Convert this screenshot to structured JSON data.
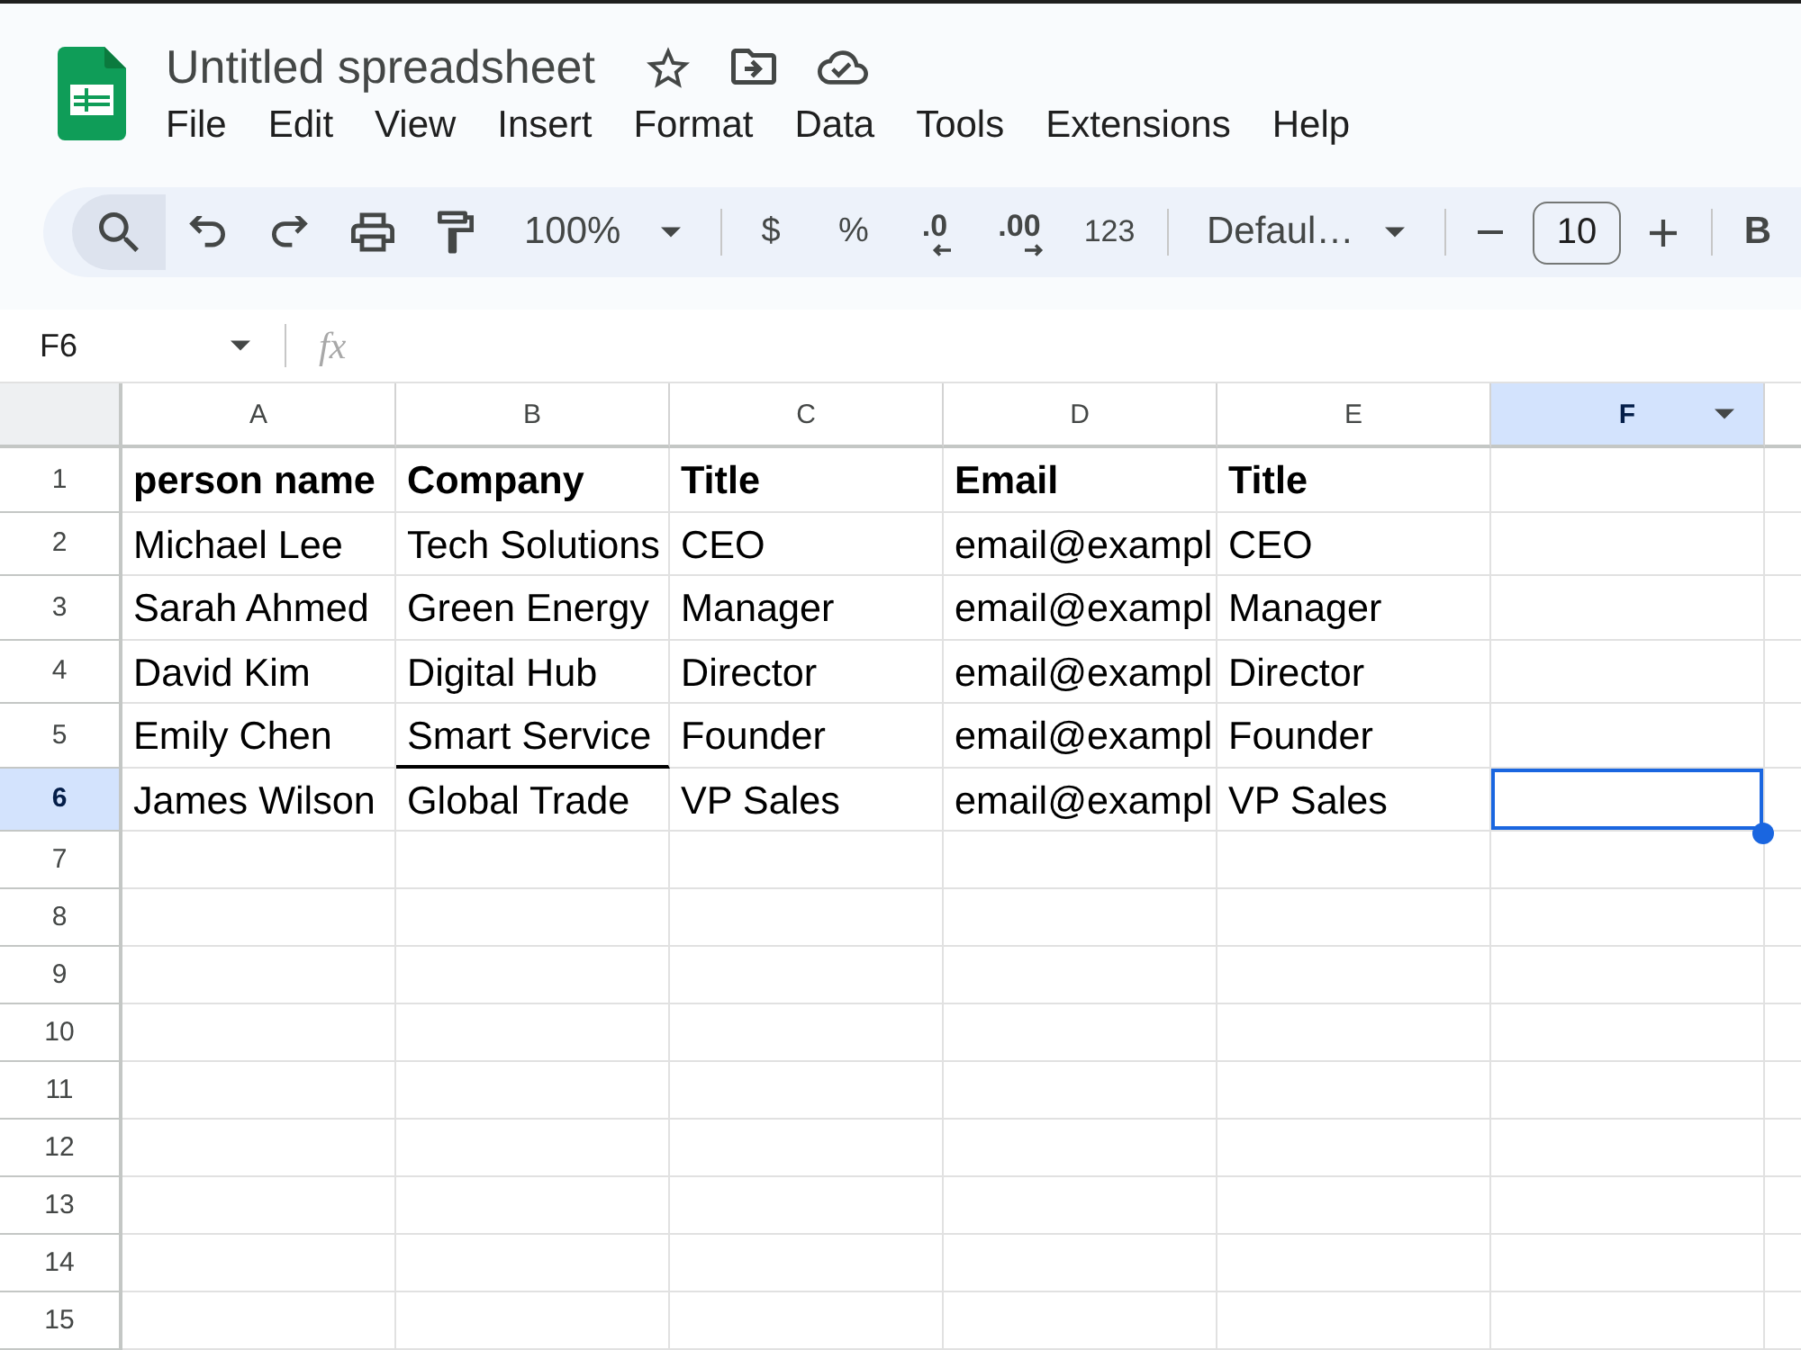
{
  "document": {
    "title": "Untitled spreadsheet"
  },
  "menu": [
    "File",
    "Edit",
    "View",
    "Insert",
    "Format",
    "Data",
    "Tools",
    "Extensions",
    "Help"
  ],
  "toolbar": {
    "search_highlighted": true,
    "zoom": "100%",
    "format_buttons": [
      {
        "kind": "currency",
        "label": "$"
      },
      {
        "kind": "percent",
        "label": "%"
      },
      {
        "kind": "decrease_decimal",
        "label": ".0"
      },
      {
        "kind": "increase_decimal",
        "label": ".00"
      },
      {
        "kind": "number_format",
        "label": "123"
      }
    ],
    "font": "Defaul…",
    "font_size": "10",
    "bold": "B"
  },
  "formula_bar": {
    "cell_reference": "F6",
    "fx": "fx"
  },
  "sheet": {
    "columns": [
      {
        "label": "A",
        "selected": false
      },
      {
        "label": "B",
        "selected": false
      },
      {
        "label": "C",
        "selected": false
      },
      {
        "label": "D",
        "selected": false
      },
      {
        "label": "E",
        "selected": false
      },
      {
        "label": "F",
        "selected": true
      }
    ],
    "rows": [
      {
        "number": "1",
        "kind": "header",
        "selected": false,
        "cells": [
          {
            "text": "person name",
            "bottom_border": false
          },
          {
            "text": "Company",
            "bottom_border": false
          },
          {
            "text": "Title",
            "bottom_border": false
          },
          {
            "text": "Email",
            "bottom_border": false
          },
          {
            "text": "Title",
            "bottom_border": false
          }
        ]
      },
      {
        "number": "2",
        "kind": "data",
        "selected": false,
        "cells": [
          {
            "text": "Michael Lee",
            "bottom_border": false
          },
          {
            "text": "Tech Solutions",
            "bottom_border": false
          },
          {
            "text": "CEO",
            "bottom_border": false
          },
          {
            "text": "email@exampl",
            "bottom_border": false
          },
          {
            "text": "CEO",
            "bottom_border": false
          }
        ]
      },
      {
        "number": "3",
        "kind": "data",
        "selected": false,
        "cells": [
          {
            "text": "Sarah Ahmed",
            "bottom_border": false
          },
          {
            "text": "Green Energy",
            "bottom_border": false
          },
          {
            "text": "Manager",
            "bottom_border": false
          },
          {
            "text": "email@exampl",
            "bottom_border": false
          },
          {
            "text": "Manager",
            "bottom_border": false
          }
        ]
      },
      {
        "number": "4",
        "kind": "data",
        "selected": false,
        "cells": [
          {
            "text": "David Kim",
            "bottom_border": false
          },
          {
            "text": "Digital Hub",
            "bottom_border": false
          },
          {
            "text": "Director",
            "bottom_border": false
          },
          {
            "text": "email@exampl",
            "bottom_border": false
          },
          {
            "text": "Director",
            "bottom_border": false
          }
        ]
      },
      {
        "number": "5",
        "kind": "data",
        "selected": false,
        "cells": [
          {
            "text": "Emily Chen",
            "bottom_border": false
          },
          {
            "text": "Smart Service",
            "bottom_border": true
          },
          {
            "text": "Founder",
            "bottom_border": false
          },
          {
            "text": "email@exampl",
            "bottom_border": false
          },
          {
            "text": "Founder",
            "bottom_border": false
          }
        ]
      },
      {
        "number": "6",
        "kind": "data",
        "selected": true,
        "cells": [
          {
            "text": "James Wilson",
            "bottom_border": false
          },
          {
            "text": "Global Trade",
            "bottom_border": false
          },
          {
            "text": "VP Sales",
            "bottom_border": false
          },
          {
            "text": "email@exampl",
            "bottom_border": false
          },
          {
            "text": "VP Sales",
            "bottom_border": false
          }
        ]
      },
      {
        "number": "7",
        "kind": "blank",
        "selected": false
      },
      {
        "number": "8",
        "kind": "blank",
        "selected": false
      },
      {
        "number": "9",
        "kind": "blank",
        "selected": false
      },
      {
        "number": "10",
        "kind": "blank",
        "selected": false
      },
      {
        "number": "11",
        "kind": "blank",
        "selected": false
      },
      {
        "number": "12",
        "kind": "blank",
        "selected": false
      },
      {
        "number": "13",
        "kind": "blank",
        "selected": false
      },
      {
        "number": "14",
        "kind": "blank",
        "selected": false
      },
      {
        "number": "15",
        "kind": "blank",
        "selected": false
      }
    ]
  }
}
